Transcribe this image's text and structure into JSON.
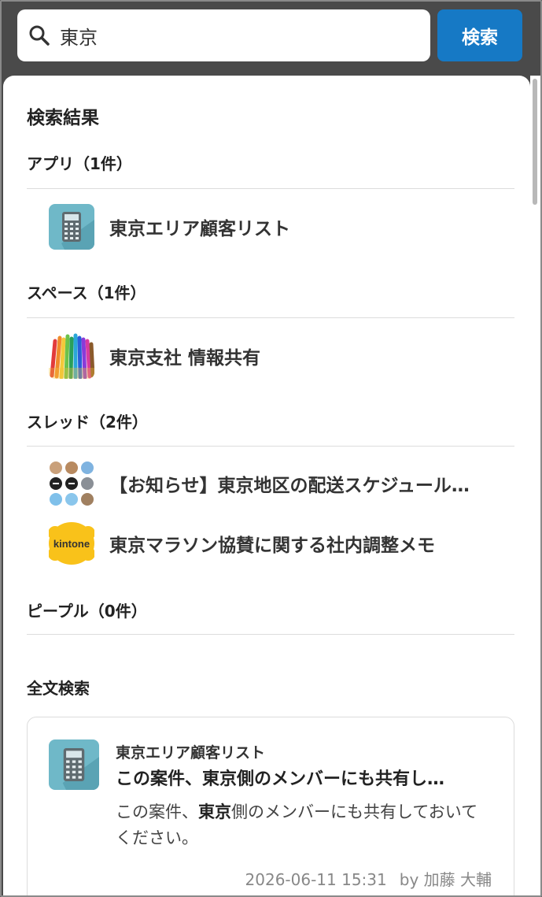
{
  "search": {
    "value": "東京",
    "button_label": "検索"
  },
  "results_title": "検索結果",
  "sections": {
    "apps": {
      "heading": "アプリ（1件）",
      "items": [
        {
          "label": "東京エリア顧客リスト",
          "icon": "phone-app-icon"
        }
      ]
    },
    "spaces": {
      "heading": "スペース（1件）",
      "items": [
        {
          "label": "東京支社 情報共有",
          "icon": "colored-pencils-icon"
        }
      ]
    },
    "threads": {
      "heading": "スレッド（2件）",
      "items": [
        {
          "label": "【お知らせ】東京地区の配送スケジュール…",
          "icon": "avatar-grid-icon"
        },
        {
          "label": "東京マラソン協賛に関する社内調整メモ",
          "icon": "kintone-logo-icon"
        }
      ]
    },
    "people": {
      "heading": "ピープル（0件）"
    }
  },
  "fulltext": {
    "heading": "全文検索",
    "card": {
      "app_name": "東京エリア顧客リスト",
      "headline": "この案件、東京側のメンバーにも共有し…",
      "body_before": "この案件、",
      "body_highlight": "東京",
      "body_after": "側のメンバーにも共有しておいてください。",
      "timestamp": "2026-06-11 15:31",
      "author": "by 加藤 大輔"
    }
  },
  "kintone_logo_text": "kintone",
  "colors": {
    "accent": "#1679c5",
    "topbar": "#4a4a4a"
  }
}
